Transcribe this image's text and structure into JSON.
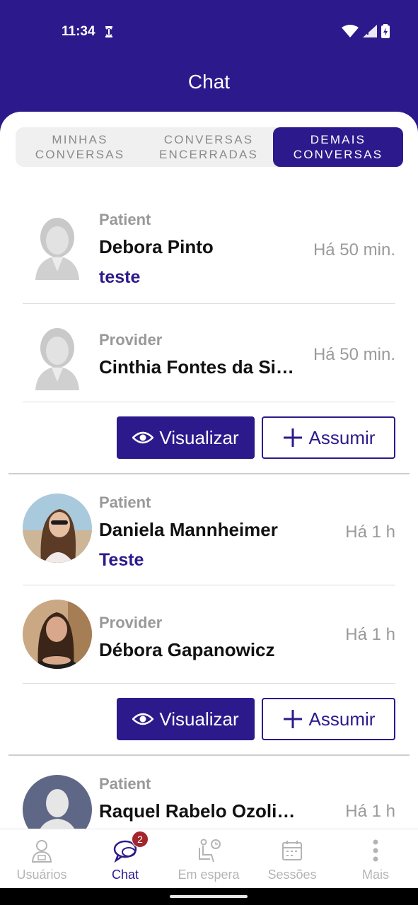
{
  "status_bar": {
    "time": "11:34"
  },
  "header": {
    "title": "Chat"
  },
  "tabs": [
    {
      "label": "Minhas conversas",
      "active": false
    },
    {
      "label": "Conversas encerradas",
      "active": false
    },
    {
      "label": "Demais conversas",
      "active": true
    }
  ],
  "conversations": [
    {
      "patient": {
        "role": "Patient",
        "name": "Debora Pinto",
        "message": "teste",
        "time": "Há 50 min.",
        "avatar": "placeholder-female-icon"
      },
      "provider": {
        "role": "Provider",
        "name": "Cinthia Fontes da Si…",
        "time": "Há 50 min.",
        "avatar": "placeholder-female-icon"
      },
      "view_label": "Visualizar",
      "take_label": "Assumir"
    },
    {
      "patient": {
        "role": "Patient",
        "name": "Daniela Mannheimer",
        "message": "Teste",
        "time": "Há 1 h",
        "avatar": "photo"
      },
      "provider": {
        "role": "Provider",
        "name": "Débora Gapanowicz",
        "time": "Há 1 h",
        "avatar": "photo"
      },
      "view_label": "Visualizar",
      "take_label": "Assumir"
    },
    {
      "patient": {
        "role": "Patient",
        "name": "Raquel Rabelo Ozolin Ri…",
        "time": "Há 1 h",
        "avatar": "placeholder-person-icon"
      }
    }
  ],
  "bottom_nav": [
    {
      "label": "Usuários",
      "icon": "user-icon",
      "active": false
    },
    {
      "label": "Chat",
      "icon": "chat-icon",
      "active": true,
      "badge": "2"
    },
    {
      "label": "Em espera",
      "icon": "waiting-icon",
      "active": false
    },
    {
      "label": "Sessões",
      "icon": "calendar-icon",
      "active": false
    },
    {
      "label": "Mais",
      "icon": "more-vertical-icon",
      "active": false
    }
  ],
  "colors": {
    "primary": "#2c1a8c",
    "badge": "#a3262c",
    "muted": "#999999"
  }
}
